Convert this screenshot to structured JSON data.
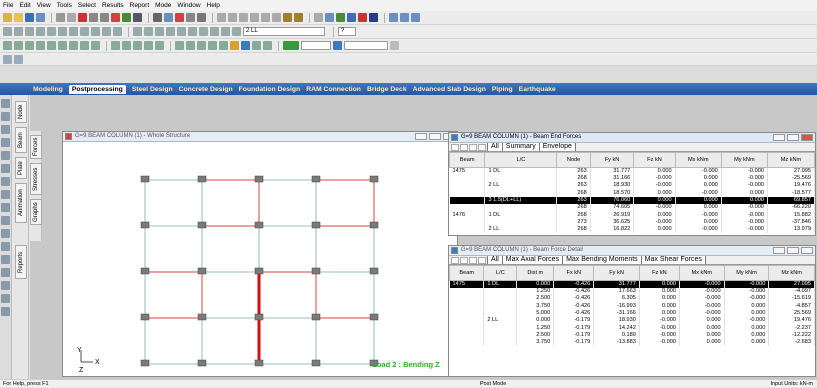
{
  "menu": [
    "File",
    "Edit",
    "View",
    "Tools",
    "Select",
    "Results",
    "Report",
    "Mode",
    "Window",
    "Help"
  ],
  "toolbar": {
    "load_case": "2 LL",
    "load_case2": "?"
  },
  "ribbon_tabs": [
    "Modeling",
    "Postprocessing",
    "Steel Design",
    "Concrete Design",
    "Foundation Design",
    "RAM Connection",
    "Bridge Deck",
    "Advanced Slab Design",
    "Piping",
    "Earthquake"
  ],
  "side_tabs": [
    "Node",
    "Beam",
    "Plate",
    "Animation",
    "Reports"
  ],
  "side_tabs2": [
    "Forces",
    "Stresses",
    "Graphs"
  ],
  "structure_window": {
    "title": "G=9 BEAM COLUMN (1) - Whole Structure",
    "load_label": "Load 2 : Bending Z",
    "axis_y": "Y",
    "axis_x": "X",
    "axis_z": "Z"
  },
  "end_forces": {
    "title": "G=9 BEAM COLUMN (1) - Beam End Forces",
    "tabs": [
      "All",
      "Summary",
      "Envelope"
    ],
    "headers": [
      "Beam",
      "L/C",
      "Node",
      "Fy kN",
      "Fz kN",
      "Mx kNm",
      "My kNm",
      "Mz kNm"
    ],
    "rows": [
      [
        "1475",
        "1 DL",
        "263",
        "31.777",
        "0.000",
        "-0.000",
        "-0.000",
        "27.095"
      ],
      [
        "",
        "",
        "268",
        "31.166",
        "-0.000",
        "0.000",
        "-0.000",
        "-25.569"
      ],
      [
        "",
        "2 LL",
        "263",
        "18.930",
        "-0.000",
        "0.000",
        "-0.000",
        "19.476"
      ],
      [
        "",
        "",
        "268",
        "18.570",
        "0.000",
        "-0.000",
        "0.000",
        "-18.577"
      ],
      [
        "",
        "3 1.5(DL+LL)",
        "263",
        "76.060",
        "0.000",
        "0.000",
        "0.000",
        "69.857"
      ],
      [
        "",
        "",
        "268",
        "74.605",
        "-0.000",
        "0.000",
        "-0.000",
        "-66.220"
      ],
      [
        "1476",
        "1 DL",
        "268",
        "26.919",
        "0.000",
        "-0.000",
        "-0.000",
        "15.882"
      ],
      [
        "",
        "",
        "273",
        "36.625",
        "-0.000",
        "0.000",
        "-0.000",
        "-37.846"
      ],
      [
        "",
        "2 LL",
        "268",
        "16.822",
        "0.000",
        "-0.000",
        "-0.000",
        "13.979"
      ]
    ],
    "selected_row": 4
  },
  "force_detail": {
    "title": "G=9 BEAM COLUMN (1) - Beam Force Detail",
    "tabs": [
      "All",
      "Max Axial Forces",
      "Max Bending Moments",
      "Max Shear Forces"
    ],
    "headers": [
      "Beam",
      "L/C",
      "Dist m",
      "Fx kN",
      "Fy kN",
      "Fz kN",
      "Mx kNm",
      "My kNm",
      "Mz kNm"
    ],
    "rows": [
      [
        "1475",
        "1 DL",
        "0.000",
        "-0.426",
        "31.777",
        "0.000",
        "-0.000",
        "-0.000",
        "27.095"
      ],
      [
        "",
        "",
        "1.250",
        "-0.426",
        "17.663",
        "0.000",
        "-0.000",
        "-0.000",
        "-4.097"
      ],
      [
        "",
        "",
        "2.500",
        "-0.426",
        "6.305",
        "0.000",
        "-0.000",
        "-0.000",
        "-15.619"
      ],
      [
        "",
        "",
        "3.750",
        "-0.426",
        "-16.993",
        "0.000",
        "-0.000",
        "0.000",
        "-4.857"
      ],
      [
        "",
        "",
        "5.000",
        "-0.426",
        "-31.166",
        "0.000",
        "-0.000",
        "0.000",
        "25.569"
      ],
      [
        "",
        "2 LL",
        "0.000",
        "-0.179",
        "18.930",
        "-0.000",
        "0.000",
        "-0.000",
        "19.476"
      ],
      [
        "",
        "",
        "1.250",
        "-0.179",
        "14.242",
        "-0.000",
        "0.000",
        "0.000",
        "-2.237"
      ],
      [
        "",
        "",
        "2.500",
        "-0.179",
        "0.180",
        "-0.000",
        "0.000",
        "0.000",
        "-12.222"
      ],
      [
        "",
        "",
        "3.750",
        "-0.179",
        "-13.883",
        "-0.000",
        "0.000",
        "0.000",
        "-2.683"
      ]
    ],
    "selected_row": 0
  },
  "status": {
    "left": "For Help, press F1",
    "middle": "Post Mode",
    "right": "Input Units: kN-m"
  }
}
